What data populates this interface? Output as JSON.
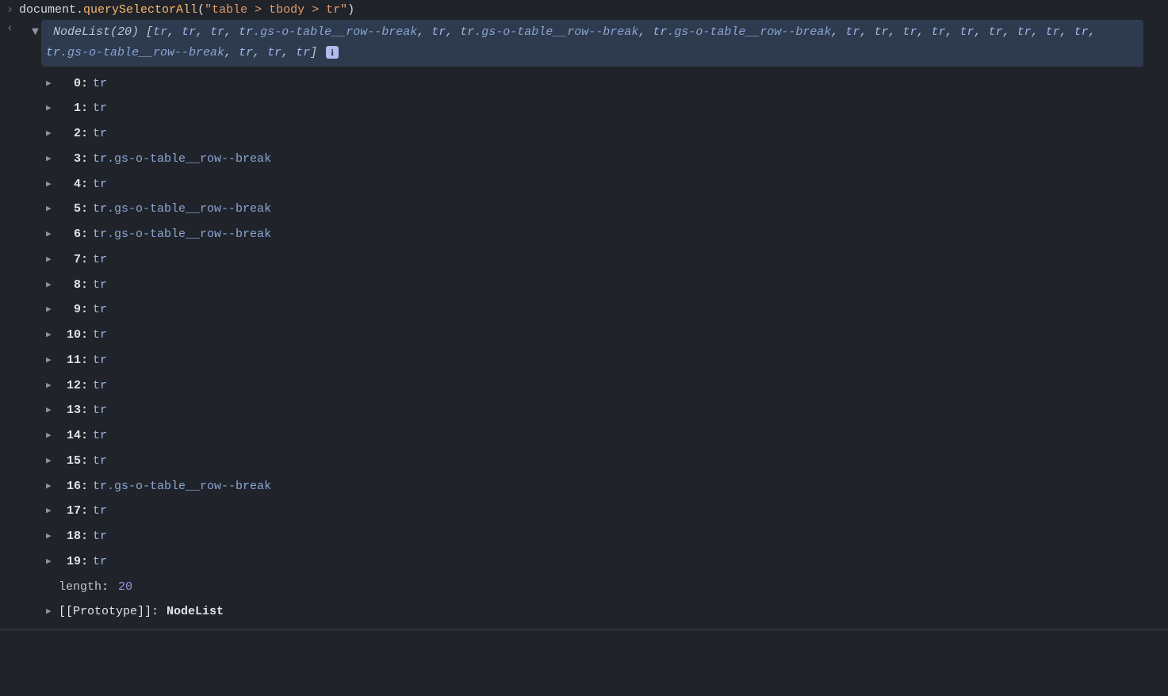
{
  "input": {
    "obj": "document",
    "dot": ".",
    "method": "querySelectorAll",
    "open": "(",
    "arg": "\"table > tbody > tr\"",
    "close": ")"
  },
  "result": {
    "typeName": "NodeList",
    "count": "(20)",
    "openBracket": " [",
    "closeBracket": "]",
    "summaryItems": [
      {
        "el": "tr",
        "cls": ""
      },
      {
        "el": "tr",
        "cls": ""
      },
      {
        "el": "tr",
        "cls": ""
      },
      {
        "el": "tr",
        "cls": ".gs-o-table__row--break"
      },
      {
        "el": "tr",
        "cls": ""
      },
      {
        "el": "tr",
        "cls": ".gs-o-table__row--break"
      },
      {
        "el": "tr",
        "cls": ".gs-o-table__row--break"
      },
      {
        "el": "tr",
        "cls": ""
      },
      {
        "el": "tr",
        "cls": ""
      },
      {
        "el": "tr",
        "cls": ""
      },
      {
        "el": "tr",
        "cls": ""
      },
      {
        "el": "tr",
        "cls": ""
      },
      {
        "el": "tr",
        "cls": ""
      },
      {
        "el": "tr",
        "cls": ""
      },
      {
        "el": "tr",
        "cls": ""
      },
      {
        "el": "tr",
        "cls": ""
      },
      {
        "el": "tr",
        "cls": ".gs-o-table__row--break"
      },
      {
        "el": "tr",
        "cls": ""
      },
      {
        "el": "tr",
        "cls": ""
      },
      {
        "el": "tr",
        "cls": ""
      }
    ],
    "infoBadge": "i",
    "entries": [
      {
        "idx": "0",
        "el": "tr",
        "cls": ""
      },
      {
        "idx": "1",
        "el": "tr",
        "cls": ""
      },
      {
        "idx": "2",
        "el": "tr",
        "cls": ""
      },
      {
        "idx": "3",
        "el": "tr",
        "cls": ".gs-o-table__row--break"
      },
      {
        "idx": "4",
        "el": "tr",
        "cls": ""
      },
      {
        "idx": "5",
        "el": "tr",
        "cls": ".gs-o-table__row--break"
      },
      {
        "idx": "6",
        "el": "tr",
        "cls": ".gs-o-table__row--break"
      },
      {
        "idx": "7",
        "el": "tr",
        "cls": ""
      },
      {
        "idx": "8",
        "el": "tr",
        "cls": ""
      },
      {
        "idx": "9",
        "el": "tr",
        "cls": ""
      },
      {
        "idx": "10",
        "el": "tr",
        "cls": ""
      },
      {
        "idx": "11",
        "el": "tr",
        "cls": ""
      },
      {
        "idx": "12",
        "el": "tr",
        "cls": ""
      },
      {
        "idx": "13",
        "el": "tr",
        "cls": ""
      },
      {
        "idx": "14",
        "el": "tr",
        "cls": ""
      },
      {
        "idx": "15",
        "el": "tr",
        "cls": ""
      },
      {
        "idx": "16",
        "el": "tr",
        "cls": ".gs-o-table__row--break"
      },
      {
        "idx": "17",
        "el": "tr",
        "cls": ""
      },
      {
        "idx": "18",
        "el": "tr",
        "cls": ""
      },
      {
        "idx": "19",
        "el": "tr",
        "cls": ""
      }
    ],
    "lengthKey": "length",
    "lengthColon": ":",
    "lengthVal": "20",
    "protoKey": "[[Prototype]]",
    "protoColon": ":",
    "protoVal": "NodeList"
  },
  "glyphs": {
    "inputPrompt": "›",
    "resultPrompt": "‹",
    "expandDown": "▼",
    "expandRight": "▶"
  }
}
